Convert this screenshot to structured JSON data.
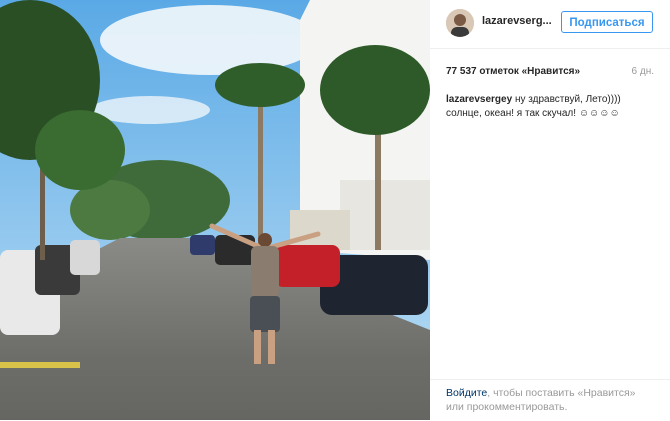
{
  "post": {
    "username": "lazarevserg...",
    "follow_label": "Подписаться",
    "likes": "77 537 отметок «Нравится»",
    "date": "6 дн.",
    "caption_user": "lazarevsergey",
    "caption_text": " ну здравствуй, Лето)))) солнце, океан! я так скучал! ☺☺☺☺"
  },
  "footer": {
    "login_link": "Войдите",
    "login_text": ", чтобы поставить «Нравится» или прокомментировать."
  },
  "icons": {
    "avatar": "user-avatar"
  },
  "colors": {
    "accent": "#3897f0",
    "link": "#003569",
    "muted": "#999999"
  }
}
